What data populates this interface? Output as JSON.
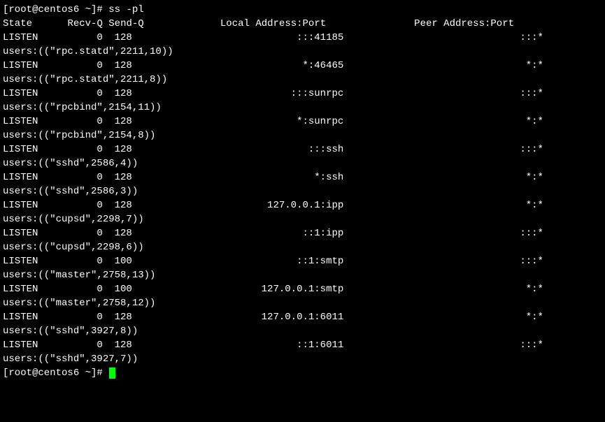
{
  "prompt1": {
    "prefix": "[root@centos6 ~]# ",
    "command": "ss -pl"
  },
  "header": {
    "state": "State",
    "recvq": "Recv-Q",
    "sendq": "Send-Q",
    "local": "Local Address:Port",
    "peer": "Peer Address:Port"
  },
  "rows": [
    {
      "state": "LISTEN",
      "recvq": "0",
      "sendq": "128",
      "local": ":::41185",
      "peer": ":::*",
      "users": "users:((\"rpc.statd\",2211,10))"
    },
    {
      "state": "LISTEN",
      "recvq": "0",
      "sendq": "128",
      "local": "*:46465",
      "peer": "*:*",
      "users": "users:((\"rpc.statd\",2211,8))"
    },
    {
      "state": "LISTEN",
      "recvq": "0",
      "sendq": "128",
      "local": ":::sunrpc",
      "peer": ":::*",
      "users": "users:((\"rpcbind\",2154,11))"
    },
    {
      "state": "LISTEN",
      "recvq": "0",
      "sendq": "128",
      "local": "*:sunrpc",
      "peer": "*:*",
      "users": "users:((\"rpcbind\",2154,8))"
    },
    {
      "state": "LISTEN",
      "recvq": "0",
      "sendq": "128",
      "local": ":::ssh",
      "peer": ":::*",
      "users": "users:((\"sshd\",2586,4))"
    },
    {
      "state": "LISTEN",
      "recvq": "0",
      "sendq": "128",
      "local": "*:ssh",
      "peer": "*:*",
      "users": "users:((\"sshd\",2586,3))"
    },
    {
      "state": "LISTEN",
      "recvq": "0",
      "sendq": "128",
      "local": "127.0.0.1:ipp",
      "peer": "*:*",
      "users": "users:((\"cupsd\",2298,7))"
    },
    {
      "state": "LISTEN",
      "recvq": "0",
      "sendq": "128",
      "local": "::1:ipp",
      "peer": ":::*",
      "users": "users:((\"cupsd\",2298,6))"
    },
    {
      "state": "LISTEN",
      "recvq": "0",
      "sendq": "100",
      "local": "::1:smtp",
      "peer": ":::*",
      "users": "users:((\"master\",2758,13))"
    },
    {
      "state": "LISTEN",
      "recvq": "0",
      "sendq": "100",
      "local": "127.0.0.1:smtp",
      "peer": "*:*",
      "users": "users:((\"master\",2758,12))"
    },
    {
      "state": "LISTEN",
      "recvq": "0",
      "sendq": "128",
      "local": "127.0.0.1:6011",
      "peer": "*:*",
      "users": "users:((\"sshd\",3927,8))"
    },
    {
      "state": "LISTEN",
      "recvq": "0",
      "sendq": "128",
      "local": "::1:6011",
      "peer": ":::*",
      "users": "users:((\"sshd\",3927,7))"
    }
  ],
  "prompt2": {
    "prefix": "[root@centos6 ~]# "
  }
}
